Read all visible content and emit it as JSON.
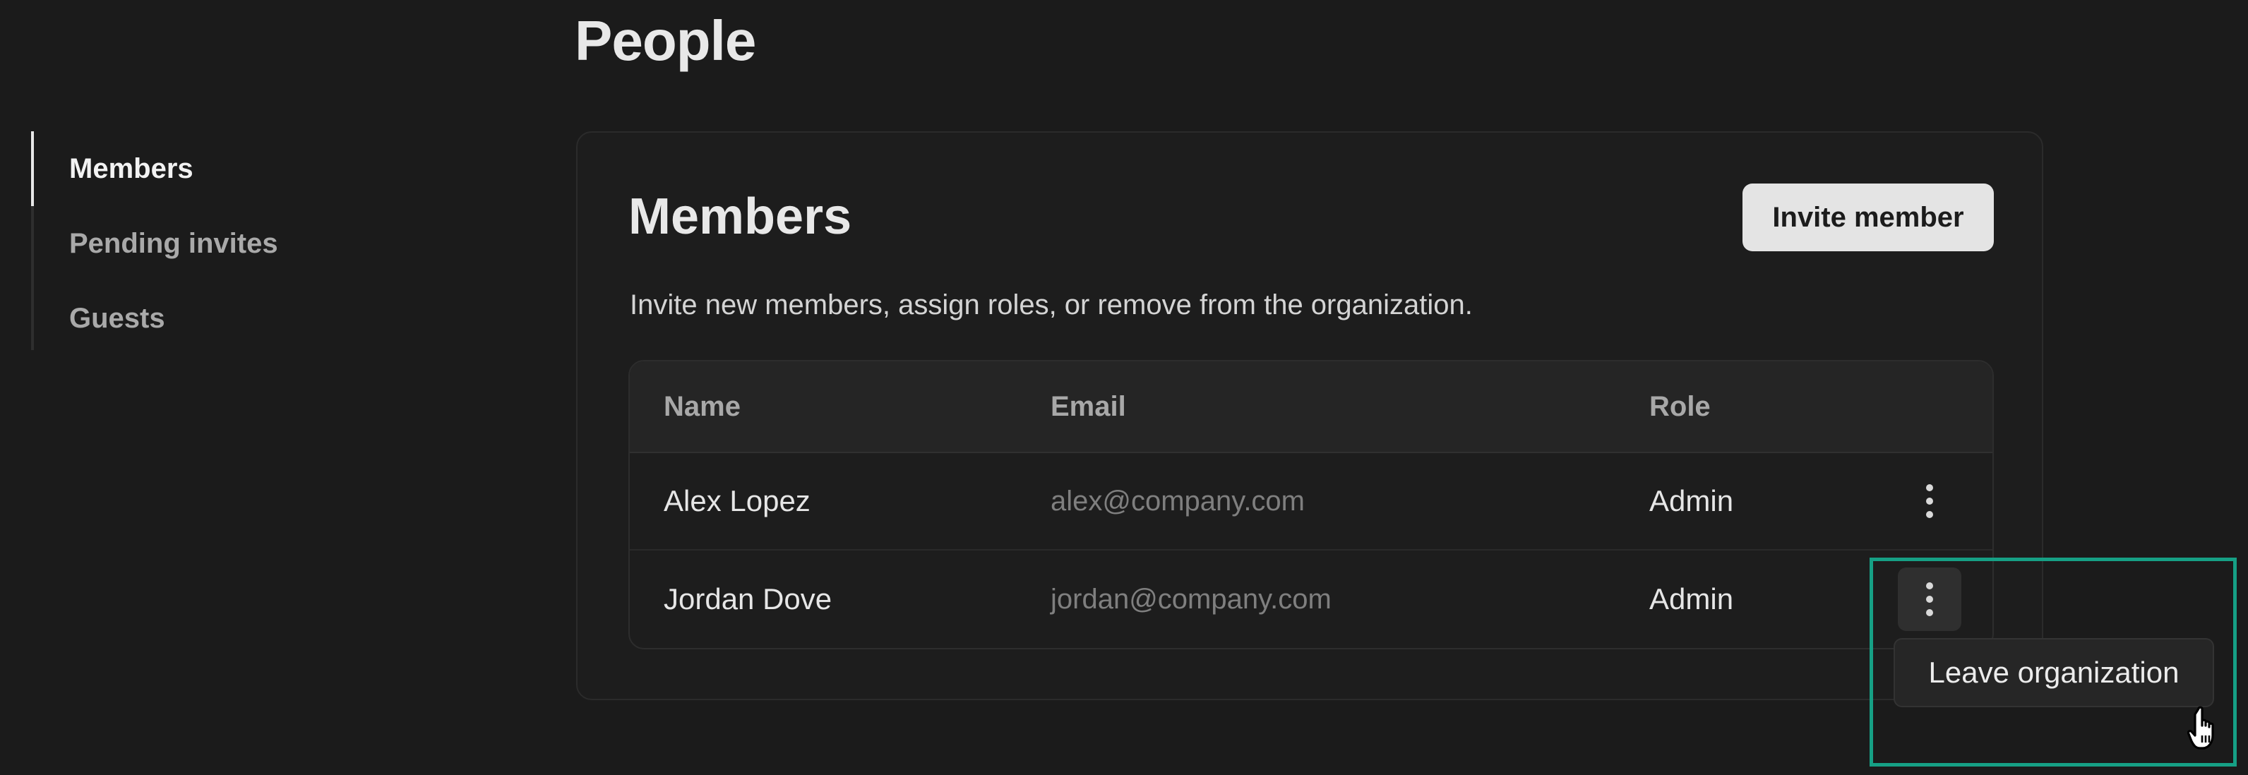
{
  "page": {
    "title": "People"
  },
  "sidebar": {
    "items": [
      {
        "label": "Members",
        "active": true
      },
      {
        "label": "Pending invites",
        "active": false
      },
      {
        "label": "Guests",
        "active": false
      }
    ]
  },
  "card": {
    "title": "Members",
    "invite_button": "Invite member",
    "description": "Invite new members, assign roles, or remove from the organization."
  },
  "table": {
    "headers": {
      "name": "Name",
      "email": "Email",
      "role": "Role"
    },
    "rows": [
      {
        "name": "Alex Lopez",
        "email": "alex@company.com",
        "role": "Admin"
      },
      {
        "name": "Jordan Dove",
        "email": "jordan@company.com",
        "role": "Admin"
      }
    ]
  },
  "menu": {
    "item": "Leave organization"
  },
  "colors": {
    "highlight": "#16a085",
    "background": "#1b1b1b"
  },
  "icons": {
    "row_actions": "more-vertical-icon",
    "cursor": "hand-pointer-icon"
  }
}
